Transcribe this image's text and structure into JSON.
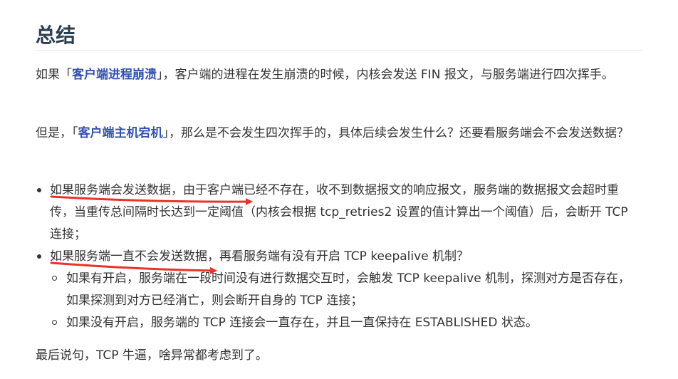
{
  "heading": "总结",
  "para1": {
    "before": "如果「",
    "highlight": "客户端进程崩溃",
    "after": "」，客户端的进程在发生崩溃的时候，内核会发送 FIN 报文，与服务端进行四次挥手。"
  },
  "para2": {
    "before": "但是，「",
    "highlight": "客户端主机宕机",
    "after": "」，那么是不会发生四次挥手的，具体后续会发生什么？还要看服务端会不会发送数据？"
  },
  "list": [
    {
      "text": "如果服务端会发送数据，由于客户端已经不存在，收不到数据报文的响应报文，服务端的数据报文会超时重传，当重传总间隔时长达到一定阈值（内核会根据 tcp_retries2 设置的值计算出一个阈值）后，会断开 TCP 连接；"
    },
    {
      "text": "如果服务端一直不会发送数据，再看服务端有没有开启 TCP keepalive 机制？",
      "sub": [
        "如果有开启，服务端在一段时间没有进行数据交互时，会触发 TCP keepalive 机制，探测对方是否存在，如果探测到对方已经消亡，则会断开自身的 TCP 连接；",
        "如果没有开启，服务端的 TCP 连接会一直存在，并且一直保持在 ESTABLISHED 状态。"
      ]
    }
  ],
  "conclusion": "最后说句，TCP 牛逼，啥异常都考虑到了。",
  "colors": {
    "highlight": "#3451b2",
    "heading": "#2c3e50",
    "annotation": "#e8322a"
  }
}
